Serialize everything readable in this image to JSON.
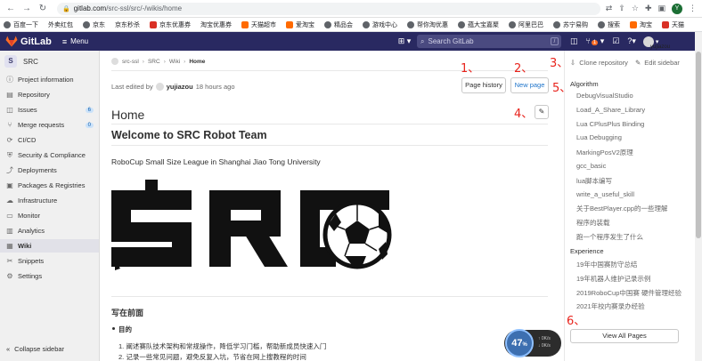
{
  "browser": {
    "url_host": "gitlab.com",
    "url_path": "/src-ssl/src/-/wikis/home",
    "profile_initial": "Y"
  },
  "bookmarks": [
    {
      "label": "百度一下",
      "icon": "globe-icon",
      "color": "#5f6368"
    },
    {
      "label": "外卖红包",
      "icon": "none",
      "color": ""
    },
    {
      "label": "京东",
      "icon": "globe-icon",
      "color": "#5f6368"
    },
    {
      "label": "京东秒杀",
      "icon": "none",
      "color": ""
    },
    {
      "label": "京东优惠券",
      "icon": "jd-icon",
      "color": "#d93025"
    },
    {
      "label": "淘宝优惠券",
      "icon": "none",
      "color": ""
    },
    {
      "label": "天猫超市",
      "icon": "taobao-icon",
      "color": "#ff6a00"
    },
    {
      "label": "爱淘宝",
      "icon": "taobao-icon",
      "color": "#ff6a00"
    },
    {
      "label": "精品会",
      "icon": "globe-icon",
      "color": "#5f6368"
    },
    {
      "label": "游戏中心",
      "icon": "globe-icon",
      "color": "#5f6368"
    },
    {
      "label": "帮你淘优惠",
      "icon": "globe-icon",
      "color": "#5f6368"
    },
    {
      "label": "蕴大宝嘉聚",
      "icon": "globe-icon",
      "color": "#5f6368"
    },
    {
      "label": "阿里巴巴",
      "icon": "globe-icon",
      "color": "#5f6368"
    },
    {
      "label": "苏宁易购",
      "icon": "globe-icon",
      "color": "#5f6368"
    },
    {
      "label": "搜索",
      "icon": "globe-icon",
      "color": "#5f6368"
    },
    {
      "label": "淘宝",
      "icon": "taobao-icon",
      "color": "#ff6a00"
    },
    {
      "label": "天猫",
      "icon": "tmall-icon",
      "color": "#d93025"
    }
  ],
  "gitlab": {
    "brand": "GitLab",
    "menu_label": "Menu",
    "search_placeholder": "Search GitLab",
    "search_shortcut": "/",
    "mr_count": "1",
    "username": "yujiazou",
    "accent_color": "#292961"
  },
  "sidebar": {
    "project_initial": "S",
    "project_name": "SRC",
    "items": [
      {
        "label": "Project information",
        "icon": "info-icon",
        "count": ""
      },
      {
        "label": "Repository",
        "icon": "doc-icon",
        "count": ""
      },
      {
        "label": "Issues",
        "icon": "issues-icon",
        "count": "6"
      },
      {
        "label": "Merge requests",
        "icon": "merge-icon",
        "count": "0"
      },
      {
        "label": "CI/CD",
        "icon": "rocket-icon",
        "count": ""
      },
      {
        "label": "Security & Compliance",
        "icon": "shield-icon",
        "count": ""
      },
      {
        "label": "Deployments",
        "icon": "deploy-icon",
        "count": ""
      },
      {
        "label": "Packages & Registries",
        "icon": "package-icon",
        "count": ""
      },
      {
        "label": "Infrastructure",
        "icon": "cloud-icon",
        "count": ""
      },
      {
        "label": "Monitor",
        "icon": "monitor-icon",
        "count": ""
      },
      {
        "label": "Analytics",
        "icon": "chart-icon",
        "count": ""
      },
      {
        "label": "Wiki",
        "icon": "book-icon",
        "count": "",
        "active": true
      },
      {
        "label": "Snippets",
        "icon": "snippet-icon",
        "count": ""
      },
      {
        "label": "Settings",
        "icon": "gear-icon",
        "count": ""
      }
    ],
    "collapse_label": "Collapse sidebar"
  },
  "breadcrumb": [
    "src-ssl",
    "SRC",
    "Wiki",
    "Home"
  ],
  "page": {
    "edited_prefix": "Last edited by",
    "edited_user": "yujiazou",
    "edited_time": "18 hours ago",
    "history_button": "Page history",
    "new_page_button": "New page",
    "title": "Home",
    "heading": "Welcome to SRC Robot Team",
    "subheading": "RoboCup Small Size League in Shanghai Jiao Tong University",
    "logo_text": "SRC",
    "section_title": "写在前面",
    "bullet": "目的",
    "ordered": [
      "1. 阐述赛队技术架构和常规操作，降低学习门槛，帮助新成员快速入门",
      "2. 记录一些常见问题，避免反复入坑，节省在网上搜教程的时间"
    ]
  },
  "wiki_sidebar": {
    "clone_label": "Clone repository",
    "edit_sidebar_label": "Edit sidebar",
    "algorithm_heading": "Algorithm",
    "algorithm_links": [
      "DebugVisualStudio",
      "Load_A_Share_Library",
      "Lua CPlusPlus Binding",
      "Lua Debugging",
      "MarkingPosV2原理",
      "gcc_basic",
      "lua脚本编写",
      "write_a_useful_skill",
      "关于BestPlayer.cpp的一些理解",
      "程序的装载",
      "跑一个程序发生了什么"
    ],
    "experience_heading": "Experience",
    "experience_links": [
      "19年中国赛防守总结",
      "19年机器人维护记录示例",
      "2019RoboCup中国赛 硬件管理经验",
      "2021年校内赛录办经验"
    ],
    "view_all_label": "View All Pages"
  },
  "annotations": [
    "1、",
    "2、",
    "3、",
    "4、",
    "5、",
    "6、"
  ],
  "speed_widget": {
    "percent": "47",
    "unit": "%",
    "up": "0K/s",
    "down": "0K/s"
  }
}
